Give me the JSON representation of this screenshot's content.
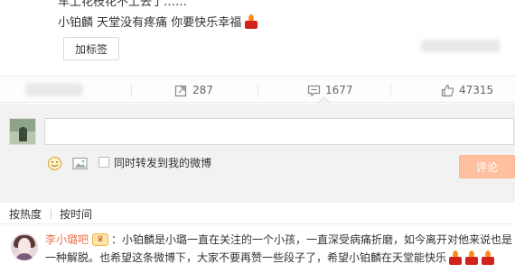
{
  "post": {
    "cut_text": "车上花枝花不上去了……",
    "text": "小铂麟 天堂没有疼痛 你要快乐幸福",
    "tag_button": "加标签"
  },
  "stats": {
    "repost_count": "287",
    "comment_count": "1677",
    "like_count": "47315"
  },
  "comment_box": {
    "placeholder": "",
    "also_repost_label": "同时转发到我的微博",
    "submit_label": "评论"
  },
  "sort": {
    "by_hot": "按热度",
    "by_time": "按时间"
  },
  "comment": {
    "user": "李小璐吧",
    "badge": "♛",
    "line1": "：小铂麟是小璐一直在关注的一个小孩，一直深受病痛折磨，如今离开对他来说也是",
    "line2": "一种解脱。也希望这条微博下，大家不要再赞一些段子了，希望小铂麟在天堂能快乐"
  },
  "icons": {
    "candle": "candle-icon",
    "repost": "repost-icon",
    "comment": "comment-icon",
    "like": "thumbs-up-icon",
    "emoji": "smiley-icon",
    "picture": "picture-icon"
  },
  "colors": {
    "accent": "#eb7350",
    "submit_disabled": "#ffc09f",
    "comment_area_bg": "#f2f2f2"
  }
}
